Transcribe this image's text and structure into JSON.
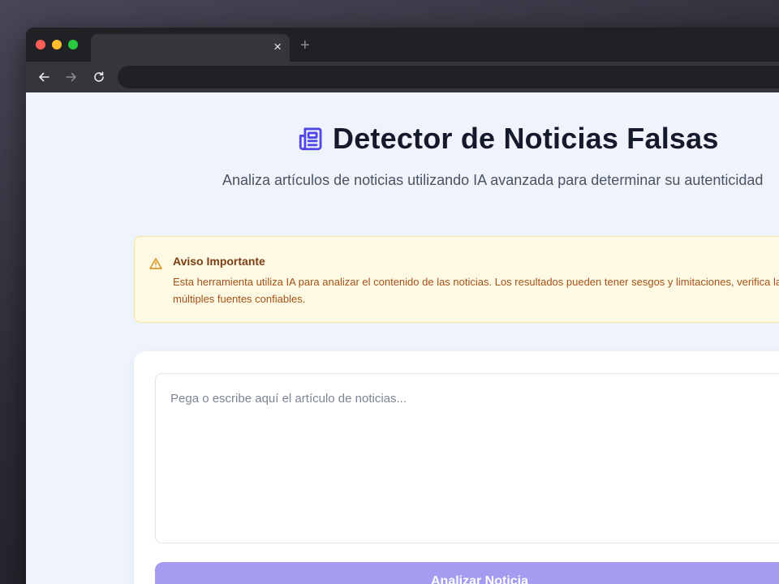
{
  "browser": {
    "tab_title": "",
    "tab_close_glyph": "×",
    "new_tab_glyph": "+",
    "address": "",
    "icons": {
      "back": "arrow-left-icon",
      "forward": "arrow-right-icon",
      "reload": "reload-icon"
    }
  },
  "header": {
    "icon": "newspaper-icon",
    "title": "Detector de Noticias Falsas",
    "subtitle": "Analiza artículos de noticias utilizando IA avanzada para determinar su autenticidad"
  },
  "alert": {
    "icon": "warning-icon",
    "title": "Aviso Importante",
    "body": "Esta herramienta utiliza IA para analizar el contenido de las noticias. Los resultados pueden tener sesgos y limitaciones, verifica la información con múltiples fuentes confiables."
  },
  "form": {
    "placeholder": "Pega o escribe aquí el artículo de noticias...",
    "value": "",
    "submit_label": "Analizar Noticia"
  },
  "colors": {
    "accent": "#6366f1",
    "button_disabled": "#a49cf0",
    "alert_bg": "#fef9e3",
    "alert_title": "#7a3e13",
    "alert_text": "#a2521a",
    "page_bg": "#eef3fc"
  }
}
